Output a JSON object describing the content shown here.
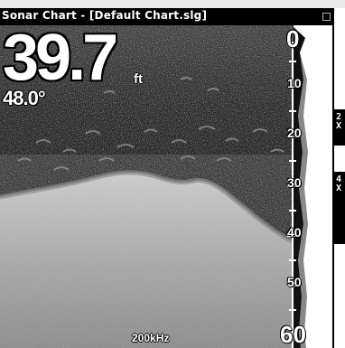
{
  "menubar": {
    "fragment": ""
  },
  "window": {
    "title": "Sonar Chart - [Default Chart.slg]"
  },
  "sonar": {
    "depth": "39.7",
    "depth_unit": "ft",
    "temperature": "48.0°",
    "frequency": "200kHz",
    "scale_top": "0",
    "scale_bottom": "60",
    "scale_labels": [
      "10",
      "20",
      "30",
      "40",
      "50"
    ]
  },
  "zoom": {
    "option_a": [
      "2",
      "X"
    ],
    "option_b": [
      "4",
      "X"
    ]
  },
  "colors": {
    "background": "#040404",
    "bottom_return": "#b8b8b8",
    "text": "#ffffff",
    "titlebar": "#000000"
  }
}
